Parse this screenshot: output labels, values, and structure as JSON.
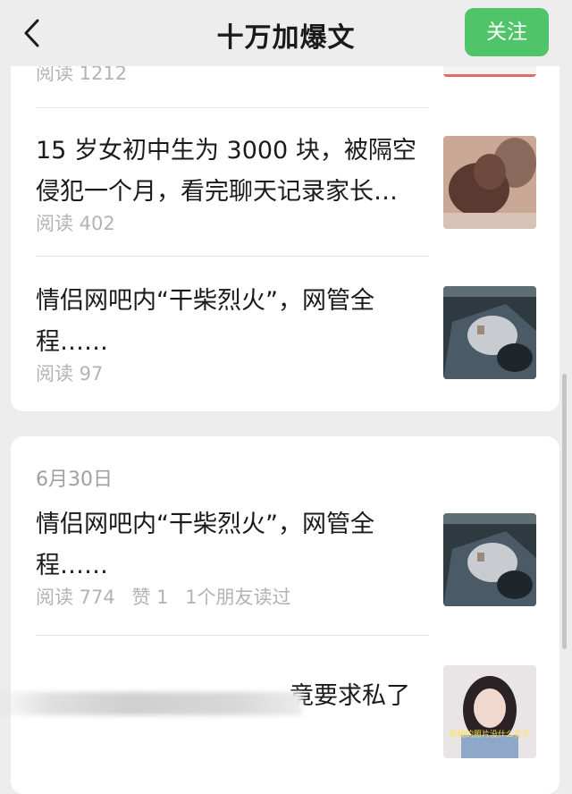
{
  "header": {
    "back_icon": "chevron-left-icon",
    "title": "十万加爆文",
    "follow_label": "关注"
  },
  "colors": {
    "accent": "#4fc469",
    "background": "#ededed"
  },
  "card1": {
    "partial_meta": "阅读 1212",
    "articles": [
      {
        "title": "15 岁女初中生为 3000 块，被隔空侵犯一个月，看完聊天记录家长…",
        "meta": [
          "阅读 402"
        ]
      },
      {
        "title": "情侣网吧内“干柴烈火”，网管全程……",
        "meta": [
          "阅读 97"
        ]
      }
    ]
  },
  "card2": {
    "date": "6月30日",
    "articles": [
      {
        "title": "情侣网吧内“干柴烈火”，网管全程……",
        "meta": [
          "阅读 774",
          "赞 1",
          "1个朋友读过"
        ]
      },
      {
        "title": "竟要求私了",
        "thumb_caption": "和我的照片没什么见不"
      }
    ]
  }
}
